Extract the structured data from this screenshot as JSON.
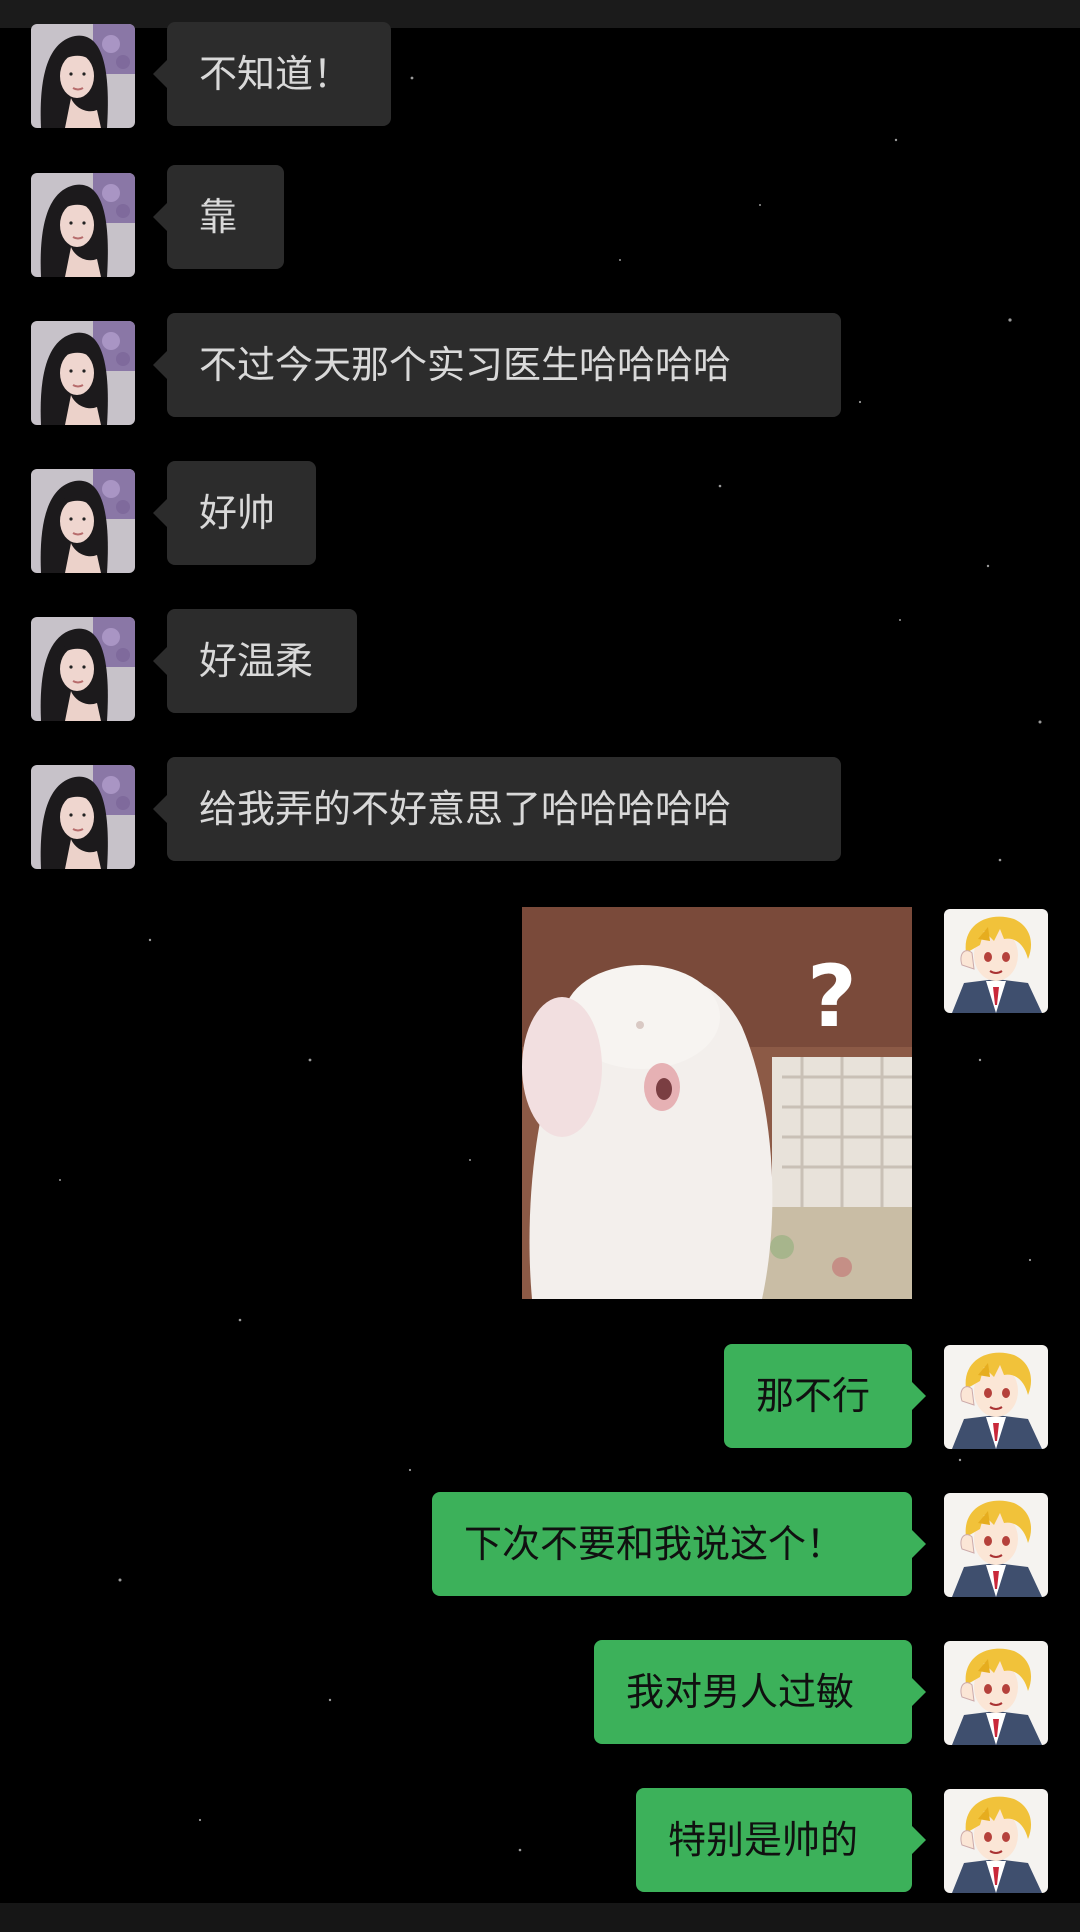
{
  "chat": {
    "messages": [
      {
        "side": "in",
        "type": "text",
        "text": "不知道！"
      },
      {
        "side": "in",
        "type": "text",
        "text": "靠"
      },
      {
        "side": "in",
        "type": "text",
        "text": "不过今天那个实习医生哈哈哈哈"
      },
      {
        "side": "in",
        "type": "text",
        "text": "好帅"
      },
      {
        "side": "in",
        "type": "text",
        "text": "好温柔"
      },
      {
        "side": "in",
        "type": "text",
        "text": "给我弄的不好意思了哈哈哈哈哈"
      },
      {
        "side": "out",
        "type": "sticker",
        "sticker": "white-rabbit-question-sticker",
        "overlay_text": "?"
      },
      {
        "side": "out",
        "type": "text",
        "text": "那不行"
      },
      {
        "side": "out",
        "type": "text",
        "text": "下次不要和我说这个！"
      },
      {
        "side": "out",
        "type": "text",
        "text": "我对男人过敏"
      },
      {
        "side": "out",
        "type": "text",
        "text": "特别是帅的"
      }
    ]
  },
  "theme": {
    "background": "#000000",
    "incoming_bubble": "#2c2c2c",
    "incoming_text": "#d9d9d9",
    "outgoing_bubble": "#3cb15a",
    "outgoing_text": "#101010"
  },
  "avatars": {
    "contact": "girl-portrait-avatar",
    "self": "anime-boy-avatar"
  }
}
